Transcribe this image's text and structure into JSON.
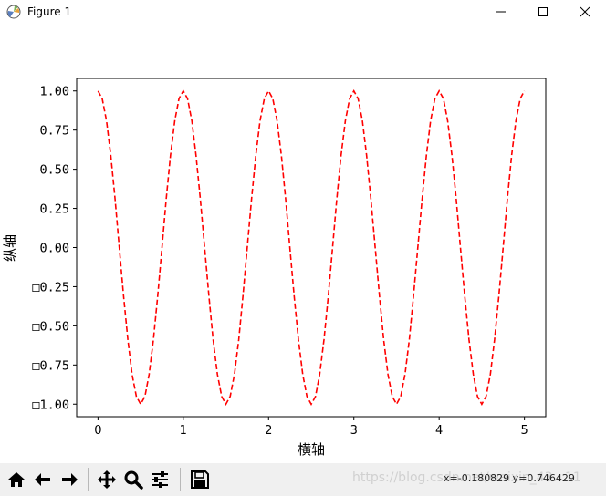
{
  "window": {
    "title": "Figure 1"
  },
  "chart_data": {
    "type": "line",
    "xlabel": "横轴",
    "ylabel": "纵轴",
    "xlim": [
      -0.25,
      5.25
    ],
    "ylim": [
      -1.08,
      1.08
    ],
    "x_ticks": [
      {
        "value": 0,
        "label": "0"
      },
      {
        "value": 1,
        "label": "1"
      },
      {
        "value": 2,
        "label": "2"
      },
      {
        "value": 3,
        "label": "3"
      },
      {
        "value": 4,
        "label": "4"
      },
      {
        "value": 5,
        "label": "5"
      }
    ],
    "y_ticks": [
      {
        "value": 1.0,
        "label": "1.00"
      },
      {
        "value": 0.75,
        "label": "0.75"
      },
      {
        "value": 0.5,
        "label": "0.50"
      },
      {
        "value": 0.25,
        "label": "0.25"
      },
      {
        "value": 0.0,
        "label": "0.00"
      },
      {
        "value": -0.25,
        "label": "□0.25"
      },
      {
        "value": -0.5,
        "label": "□0.50"
      },
      {
        "value": -0.75,
        "label": "□0.75"
      },
      {
        "value": -1.0,
        "label": "□1.00"
      }
    ],
    "series": [
      {
        "color": "#ff0000",
        "line_style": "dashed",
        "x": [
          0.0,
          0.05,
          0.1,
          0.15,
          0.2,
          0.25,
          0.3,
          0.35,
          0.4,
          0.45,
          0.5,
          0.55,
          0.6,
          0.65,
          0.7,
          0.75,
          0.8,
          0.85,
          0.9,
          0.95,
          1.0,
          1.05,
          1.1,
          1.15,
          1.2,
          1.25,
          1.3,
          1.35,
          1.4,
          1.45,
          1.5,
          1.55,
          1.6,
          1.65,
          1.7,
          1.75,
          1.8,
          1.85,
          1.9,
          1.95,
          2.0,
          2.05,
          2.1,
          2.15,
          2.2,
          2.25,
          2.3,
          2.35,
          2.4,
          2.45,
          2.5,
          2.55,
          2.6,
          2.65,
          2.7,
          2.75,
          2.8,
          2.85,
          2.9,
          2.95,
          3.0,
          3.05,
          3.1,
          3.15,
          3.2,
          3.25,
          3.3,
          3.35,
          3.4,
          3.45,
          3.5,
          3.55,
          3.6,
          3.65,
          3.7,
          3.75,
          3.8,
          3.85,
          3.9,
          3.95,
          4.0,
          4.05,
          4.1,
          4.15,
          4.2,
          4.25,
          4.3,
          4.35,
          4.4,
          4.45,
          4.5,
          4.55,
          4.6,
          4.65,
          4.7,
          4.75,
          4.8,
          4.85,
          4.9,
          4.95,
          5.0
        ],
        "y": [
          1.0,
          0.951,
          0.809,
          0.588,
          0.309,
          0.0,
          -0.309,
          -0.588,
          -0.809,
          -0.951,
          -1.0,
          -0.951,
          -0.809,
          -0.588,
          -0.309,
          0.0,
          0.309,
          0.588,
          0.809,
          0.951,
          1.0,
          0.951,
          0.809,
          0.588,
          0.309,
          0.0,
          -0.309,
          -0.588,
          -0.809,
          -0.951,
          -1.0,
          -0.951,
          -0.809,
          -0.588,
          -0.309,
          0.0,
          0.309,
          0.588,
          0.809,
          0.951,
          1.0,
          0.951,
          0.809,
          0.588,
          0.309,
          0.0,
          -0.309,
          -0.588,
          -0.809,
          -0.951,
          -1.0,
          -0.951,
          -0.809,
          -0.588,
          -0.309,
          0.0,
          0.309,
          0.588,
          0.809,
          0.951,
          1.0,
          0.951,
          0.809,
          0.588,
          0.309,
          0.0,
          -0.309,
          -0.588,
          -0.809,
          -0.951,
          -1.0,
          -0.951,
          -0.809,
          -0.588,
          -0.309,
          0.0,
          0.309,
          0.588,
          0.809,
          0.951,
          1.0,
          0.951,
          0.809,
          0.588,
          0.309,
          0.0,
          -0.309,
          -0.588,
          -0.809,
          -0.951,
          -1.0,
          -0.951,
          -0.809,
          -0.588,
          -0.309,
          0.0,
          0.309,
          0.588,
          0.809,
          0.951,
          1.0
        ]
      }
    ],
    "grid": false,
    "legend": "none"
  },
  "toolbar": {
    "buttons": [
      {
        "name": "home-button",
        "icon": "home-icon"
      },
      {
        "name": "back-button",
        "icon": "arrow-left-icon"
      },
      {
        "name": "forward-button",
        "icon": "arrow-right-icon"
      },
      {
        "name": "pan-button",
        "icon": "move-icon"
      },
      {
        "name": "zoom-button",
        "icon": "magnifier-icon"
      },
      {
        "name": "configure-subplots-button",
        "icon": "sliders-icon"
      },
      {
        "name": "save-button",
        "icon": "floppy-disk-icon"
      }
    ],
    "coords_text": "x=-0.180829   y=0.746429",
    "watermark": "https://blog.csdn.net/weixin_43...11"
  }
}
